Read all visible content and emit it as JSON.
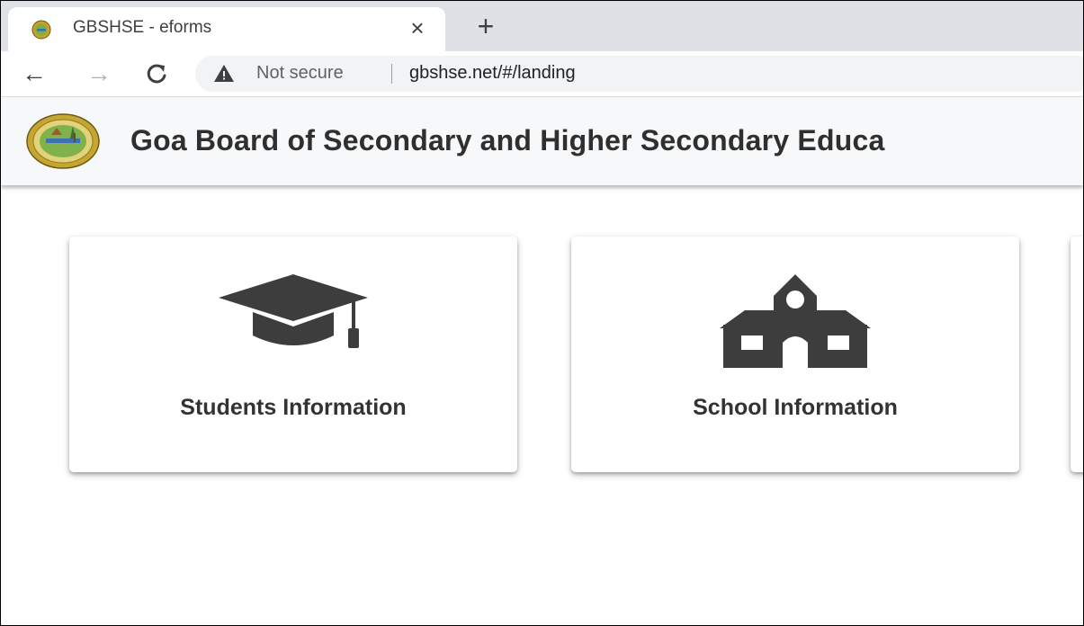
{
  "browser": {
    "tab": {
      "title": "GBSHSE - eforms",
      "close_glyph": "×",
      "favicon": "site-emblem-icon"
    },
    "new_tab_glyph": "+",
    "nav": {
      "back_glyph": "←",
      "forward_glyph": "→",
      "reload_glyph": "C"
    },
    "address_bar": {
      "security_label": "Not secure",
      "url": "gbshse.net/#/landing",
      "warning_icon": "warning-triangle-icon"
    }
  },
  "header": {
    "title": "Goa Board of Secondary and Higher Secondary Educa"
  },
  "cards": [
    {
      "label": "Students Information",
      "icon": "graduation-cap-icon"
    },
    {
      "label": "School Information",
      "icon": "school-building-icon"
    }
  ],
  "colors": {
    "tab_strip": "#dee1e6",
    "icon_gray": "#3d3d3d",
    "text_dark": "#333333"
  }
}
